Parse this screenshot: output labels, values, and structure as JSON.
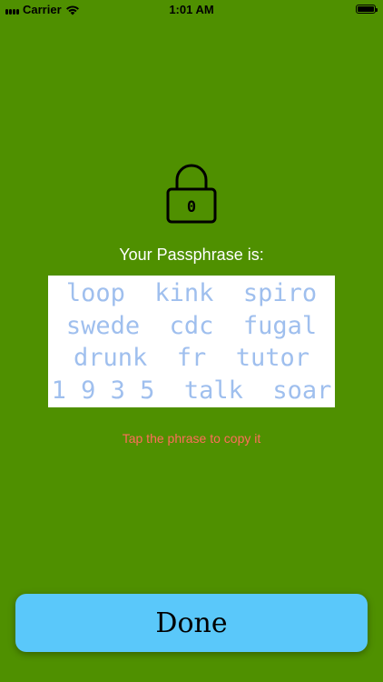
{
  "status_bar": {
    "carrier": "Carrier",
    "time": "1:01 AM",
    "battery_level": 1.0
  },
  "lock_icon": {
    "digit": "0"
  },
  "passphrase": {
    "label": "Your Passphrase is:",
    "lines": [
      "loop  kink  spiro",
      "swede  cdc  fugal",
      "drunk  fr  tutor",
      "1 9 3 5  talk  soar"
    ]
  },
  "hint": "Tap the phrase to copy it",
  "done_button": {
    "label": "Done"
  },
  "colors": {
    "background": "#4f9000",
    "phrase_text": "#9fbfee",
    "hint_text": "#ff6e5a",
    "button": "#5ac8fa"
  }
}
